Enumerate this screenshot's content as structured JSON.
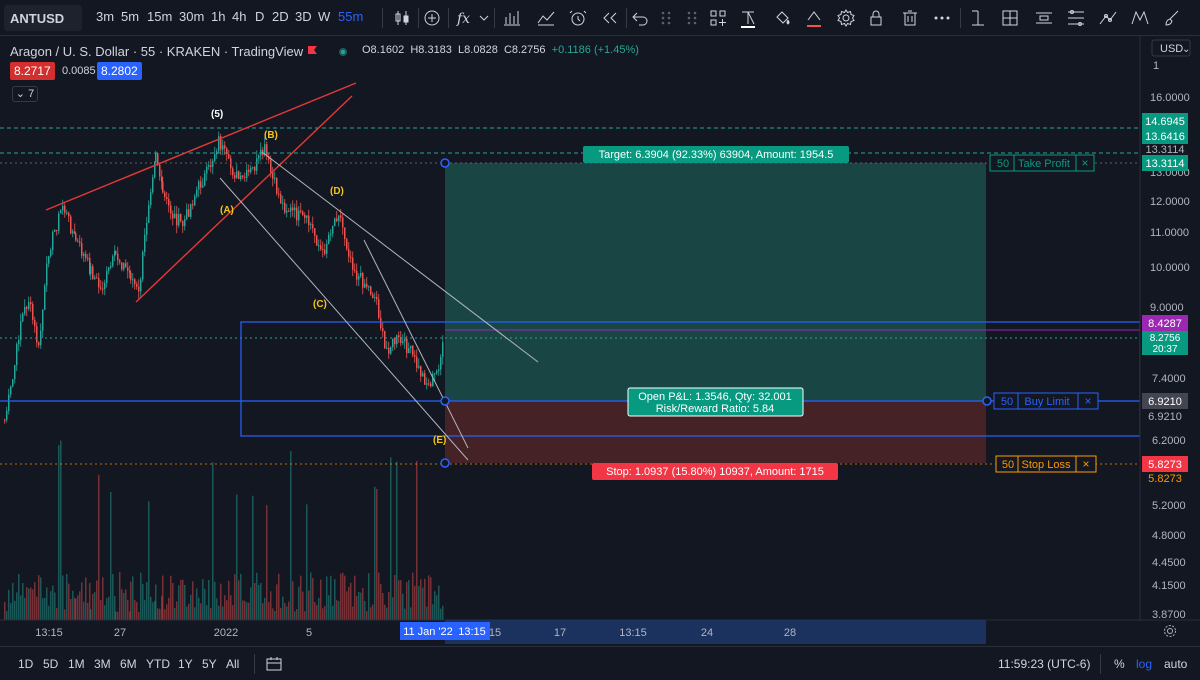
{
  "toolbar": {
    "symbol": "ANTUSD",
    "intervals": [
      "3m",
      "5m",
      "15m",
      "30m",
      "1h",
      "4h",
      "D",
      "2D",
      "3D",
      "W",
      "55m"
    ],
    "active_interval": "55m"
  },
  "legend": {
    "title": "Aragon / U. S. Dollar · 55 · KRAKEN · TradingView",
    "open": "O8.1602",
    "high": "H8.3183",
    "low": "L8.0828",
    "close": "C8.2756",
    "change": "+0.1186 (+1.45%)",
    "bid": "8.2717",
    "spread": "0.0085",
    "ask": "8.2802",
    "indicator_count": "7"
  },
  "currency": "USD",
  "price_axis": {
    "ticks": [
      "16.0000",
      "13.0000",
      "12.0000",
      "11.0000",
      "10.0000",
      "9.0000",
      "7.4000",
      "6.2000",
      "5.2000",
      "4.8000",
      "4.4500",
      "4.1500",
      "3.8700"
    ],
    "min_label": "1"
  },
  "price_labels": [
    {
      "value": "14.6945",
      "bg": "#089981",
      "fg": "#ffffff"
    },
    {
      "value": "13.6416",
      "bg": "#089981",
      "fg": "#ffffff"
    },
    {
      "value": "13.3114",
      "bg": "#131722",
      "fg": "#b2b5be"
    },
    {
      "value": "13.3114",
      "bg": "#089981",
      "fg": "#ffffff"
    },
    {
      "value": "8.4287",
      "bg": "#9c27b0",
      "fg": "#ffffff"
    },
    {
      "value": "8.2756",
      "bg": "#089981",
      "fg": "#ffffff"
    },
    {
      "value": "20:37",
      "bg": "#089981",
      "fg": "#ffffff"
    },
    {
      "value": "6.9210",
      "bg": "#434651",
      "fg": "#ffffff"
    },
    {
      "value": "6.9210",
      "bg": "#131722",
      "fg": "#b2b5be"
    },
    {
      "value": "5.8273",
      "bg": "#f23645",
      "fg": "#ffffff"
    },
    {
      "value": "5.8273",
      "bg": "#131722",
      "fg": "#ff9800"
    }
  ],
  "time_axis": {
    "ticks": [
      "13:15",
      "27",
      "2022",
      "5",
      "15",
      "17",
      "13:15",
      "24",
      "28"
    ],
    "highlight": "11 Jan '22",
    "highlight_time": "13:15"
  },
  "orders": {
    "take_profit": {
      "qty": "50",
      "label": "Take Profit",
      "close": "×"
    },
    "buy_limit": {
      "qty": "50",
      "label": "Buy Limit",
      "close": "×"
    },
    "stop_loss": {
      "qty": "50",
      "label": "Stop Loss",
      "close": "×"
    }
  },
  "position": {
    "target": "Target: 6.3904 (92.33%) 63904, Amount: 1954.5",
    "stop": "Stop: 1.0937 (15.80%) 10937, Amount: 1715",
    "pnl": "Open P&L: 1.3546, Qty: 32.001",
    "rr": "Risk/Reward Ratio: 5.84"
  },
  "wave_labels": [
    "(5)",
    "(B)",
    "(A)",
    "(D)",
    "(C)",
    "(E)"
  ],
  "bottom_bar": {
    "ranges": [
      "1D",
      "5D",
      "1M",
      "3M",
      "6M",
      "YTD",
      "1Y",
      "5Y",
      "All"
    ],
    "clock": "11:59:23 (UTC-6)",
    "percent": "%",
    "log": "log",
    "auto": "auto"
  },
  "colors": {
    "up": "#26a69a",
    "down": "#ef5350",
    "accent": "#2962ff",
    "trend_red": "#e53935",
    "wave_yellow": "#f5c518"
  },
  "chart_data": {
    "type": "candlestick",
    "ohlc_last": {
      "open": 8.1602,
      "high": 8.3183,
      "low": 8.0828,
      "close": 8.2756
    },
    "key_levels": {
      "entry": 6.921,
      "target": 13.3114,
      "stop": 5.8273,
      "last": 8.2756,
      "purple": 8.4287,
      "high1": 14.6945,
      "high2": 13.6416
    }
  }
}
